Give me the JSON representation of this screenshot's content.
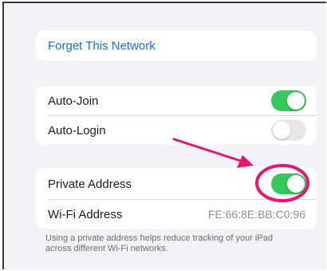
{
  "forget": {
    "label": "Forget This Network"
  },
  "join_group": {
    "auto_join": {
      "label": "Auto-Join",
      "enabled": true
    },
    "auto_login": {
      "label": "Auto-Login",
      "enabled": false
    }
  },
  "privacy_group": {
    "private_address": {
      "label": "Private Address",
      "enabled": true
    },
    "wifi_address": {
      "label": "Wi-Fi Address",
      "value": "FE:66:8E:BB:C0:96"
    }
  },
  "footnote": "Using a private address helps reduce tracking of your iPad across different Wi-Fi networks.",
  "colors": {
    "accent_link": "#1a6fe0",
    "toggle_on": "#34c759",
    "annotation": "#e6176f"
  }
}
